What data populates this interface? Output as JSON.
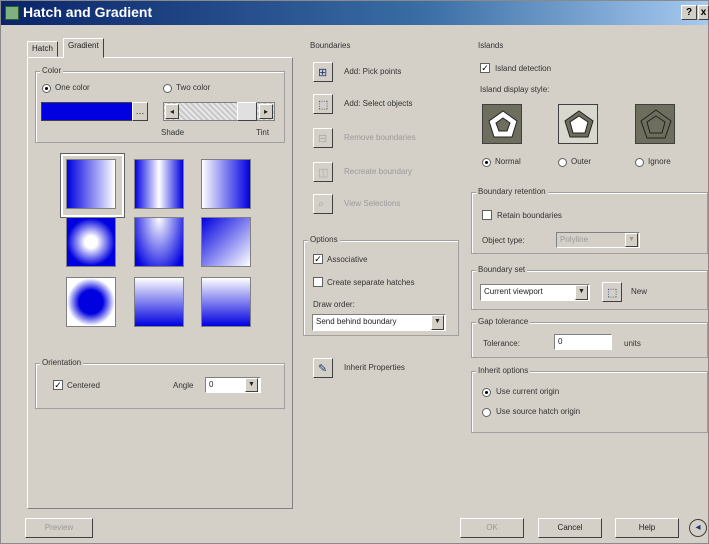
{
  "window": {
    "title": "Hatch and Gradient",
    "help": "?",
    "close": "x"
  },
  "tabs": [
    {
      "label": "Hatch"
    },
    {
      "label": "Gradient"
    }
  ],
  "color": {
    "group_title": "Color",
    "one_color": "One color",
    "two_color": "Two color",
    "selected": "One color",
    "swatch_color": "#0000e0",
    "shade_label": "Shade",
    "tint_label": "Tint",
    "slider_left": "◂",
    "slider_right": "▸"
  },
  "orientation": {
    "group_title": "Orientation",
    "centered_label": "Centered",
    "centered_checked": true,
    "angle_label": "Angle",
    "angle_value": "0"
  },
  "boundaries": {
    "group_title": "Boundaries",
    "add_pick_points": "Add: Pick points",
    "add_select_objects": "Add: Select objects",
    "remove_boundaries": "Remove boundaries",
    "recreate_boundary": "Recreate boundary",
    "view_selections": "View Selections"
  },
  "options": {
    "group_title": "Options",
    "associative": "Associative",
    "associative_checked": true,
    "separate_hatches": "Create separate hatches",
    "separate_checked": false,
    "draw_order_label": "Draw order:",
    "draw_order_value": "Send behind boundary"
  },
  "inherit_properties": "Inherit Properties",
  "islands": {
    "group_title": "Islands",
    "detection_label": "Island detection",
    "detection_checked": true,
    "style_label": "Island display style:",
    "styles": [
      "Normal",
      "Outer",
      "Ignore"
    ],
    "selected": "Normal"
  },
  "boundary_retention": {
    "group_title": "Boundary retention",
    "retain_label": "Retain boundaries",
    "retain_checked": false,
    "object_type_label": "Object type:",
    "object_type_value": "Polyline"
  },
  "boundary_set": {
    "group_title": "Boundary set",
    "value": "Current viewport",
    "new_label": "New"
  },
  "gap_tolerance": {
    "group_title": "Gap tolerance",
    "tolerance_label": "Tolerance:",
    "value": "0",
    "units_label": "units"
  },
  "inherit_options": {
    "group_title": "Inherit options",
    "current_origin": "Use current origin",
    "source_origin": "Use source hatch origin",
    "selected": "Use current origin"
  },
  "buttons": {
    "preview": "Preview",
    "ok": "OK",
    "cancel": "Cancel",
    "help": "Help",
    "more": "◂"
  },
  "icons": {
    "add_pick_points": "pick-points-icon",
    "add_select_objects": "select-objects-icon",
    "remove_boundaries": "remove-boundaries-icon",
    "recreate_boundary": "recreate-boundary-icon",
    "view_selections": "view-selections-icon",
    "inherit_properties": "inherit-properties-icon",
    "boundary_set_new": "new-boundary-set-icon"
  }
}
